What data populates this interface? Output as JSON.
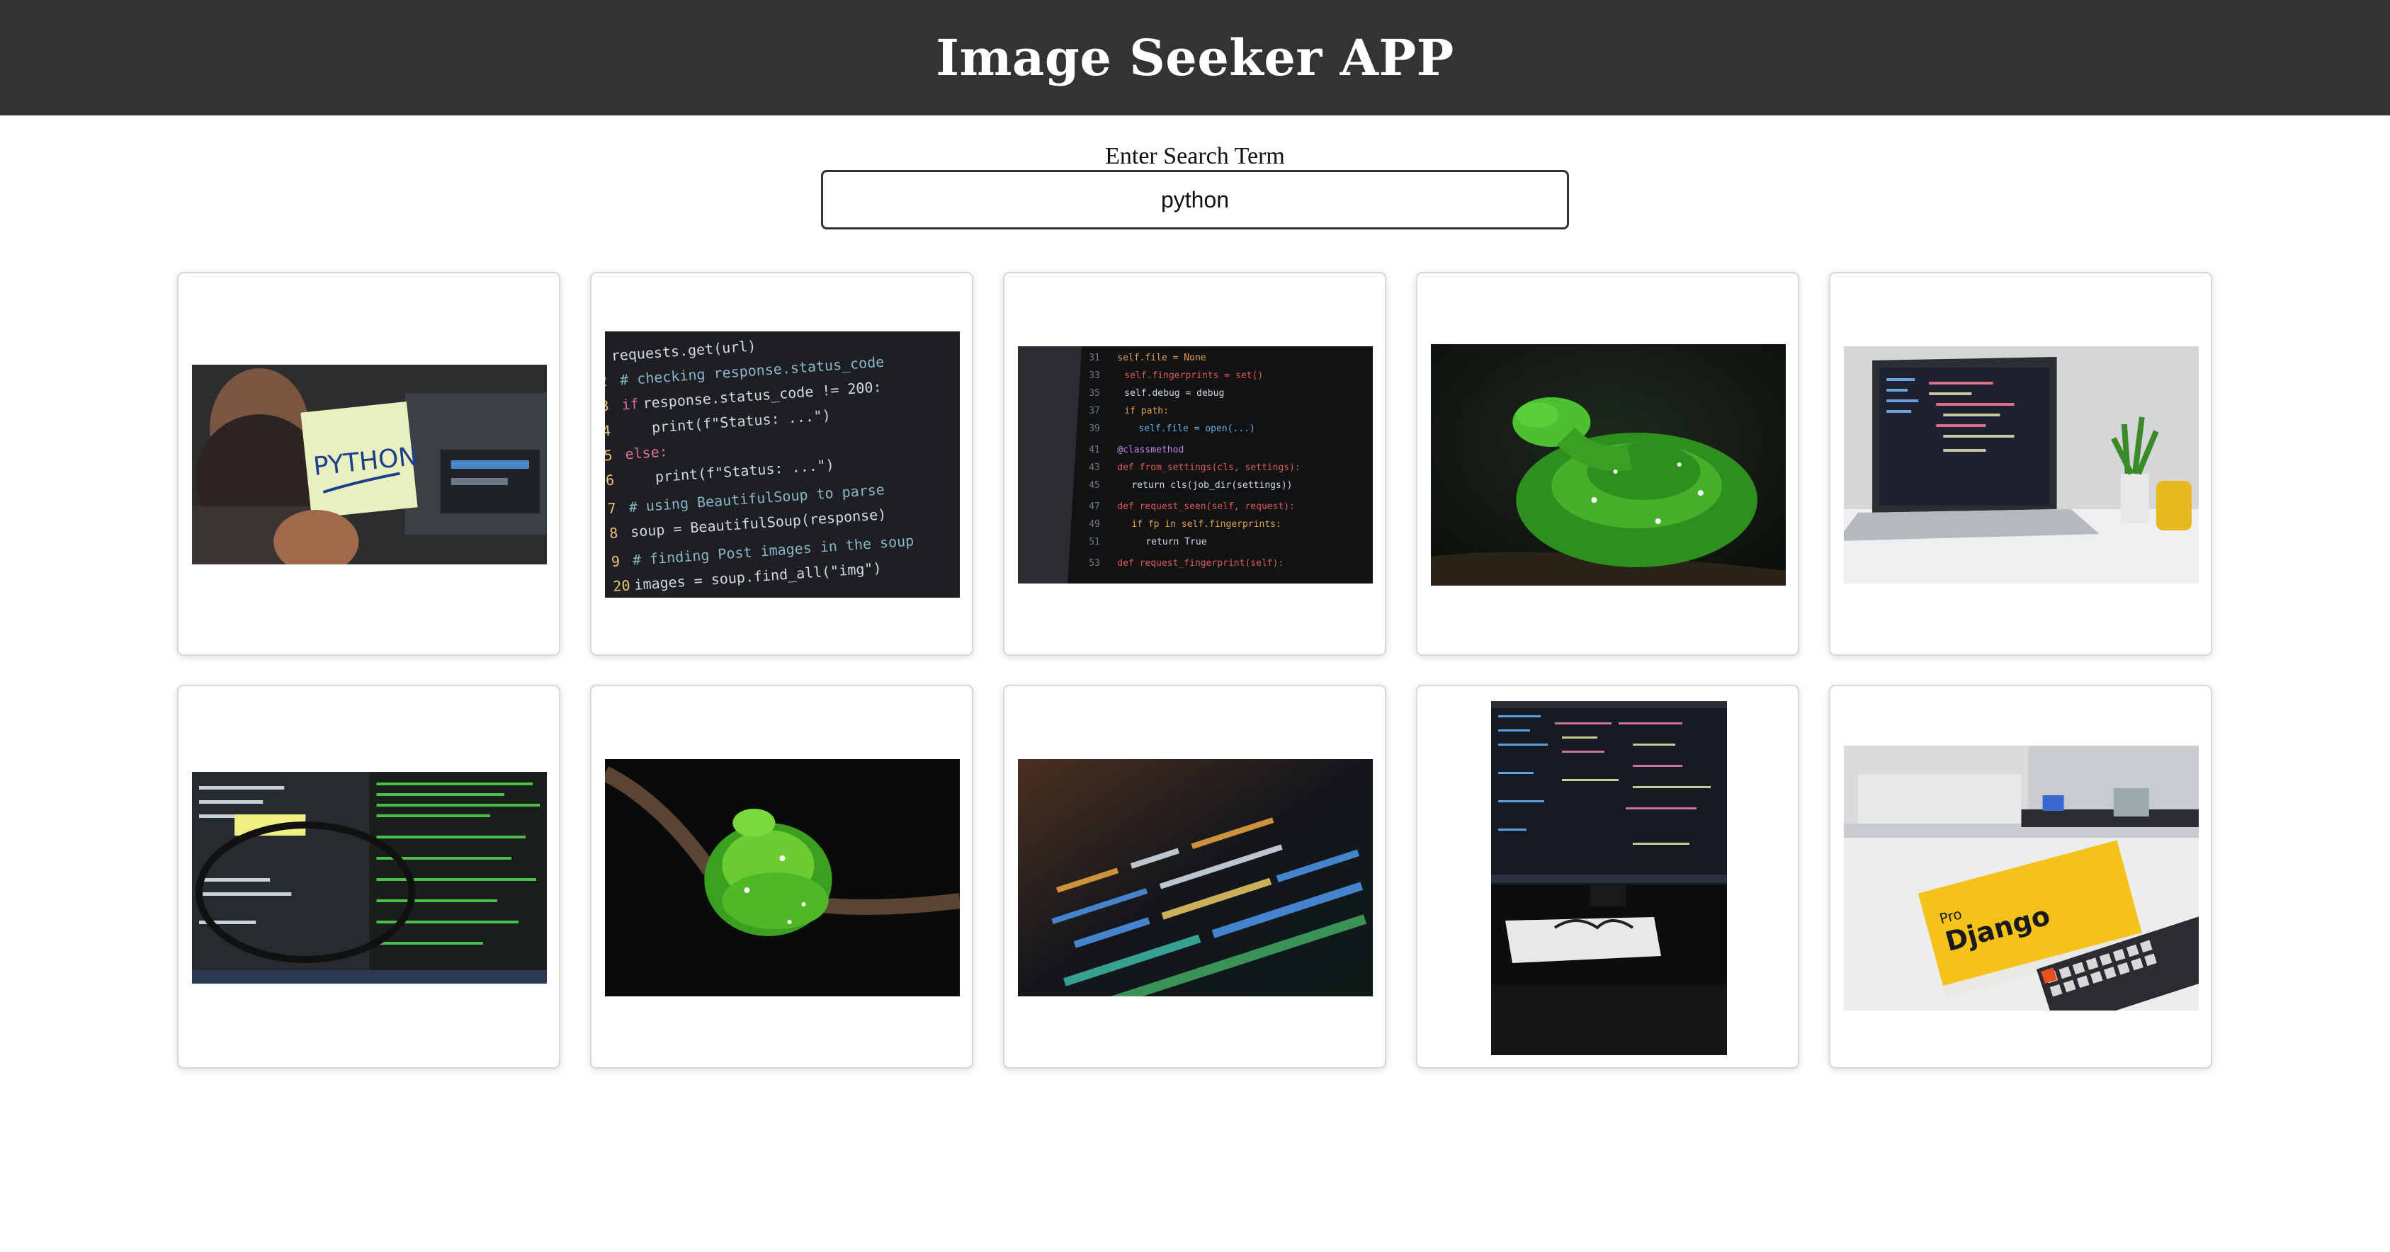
{
  "header": {
    "title": "Image Seeker APP",
    "background": "#333333"
  },
  "search": {
    "label": "Enter Search Term",
    "value": "python"
  },
  "results": [
    {
      "icon": "python-sticky-note-photo"
    },
    {
      "icon": "python-code-screen-photo"
    },
    {
      "icon": "code-monitor-photo"
    },
    {
      "icon": "green-snake-photo"
    },
    {
      "icon": "laptop-desk-photo"
    },
    {
      "icon": "glasses-code-photo"
    },
    {
      "icon": "green-snake-branch-photo"
    },
    {
      "icon": "blurred-code-photo"
    },
    {
      "icon": "monitor-desk-photo"
    },
    {
      "icon": "django-book-photo"
    }
  ]
}
